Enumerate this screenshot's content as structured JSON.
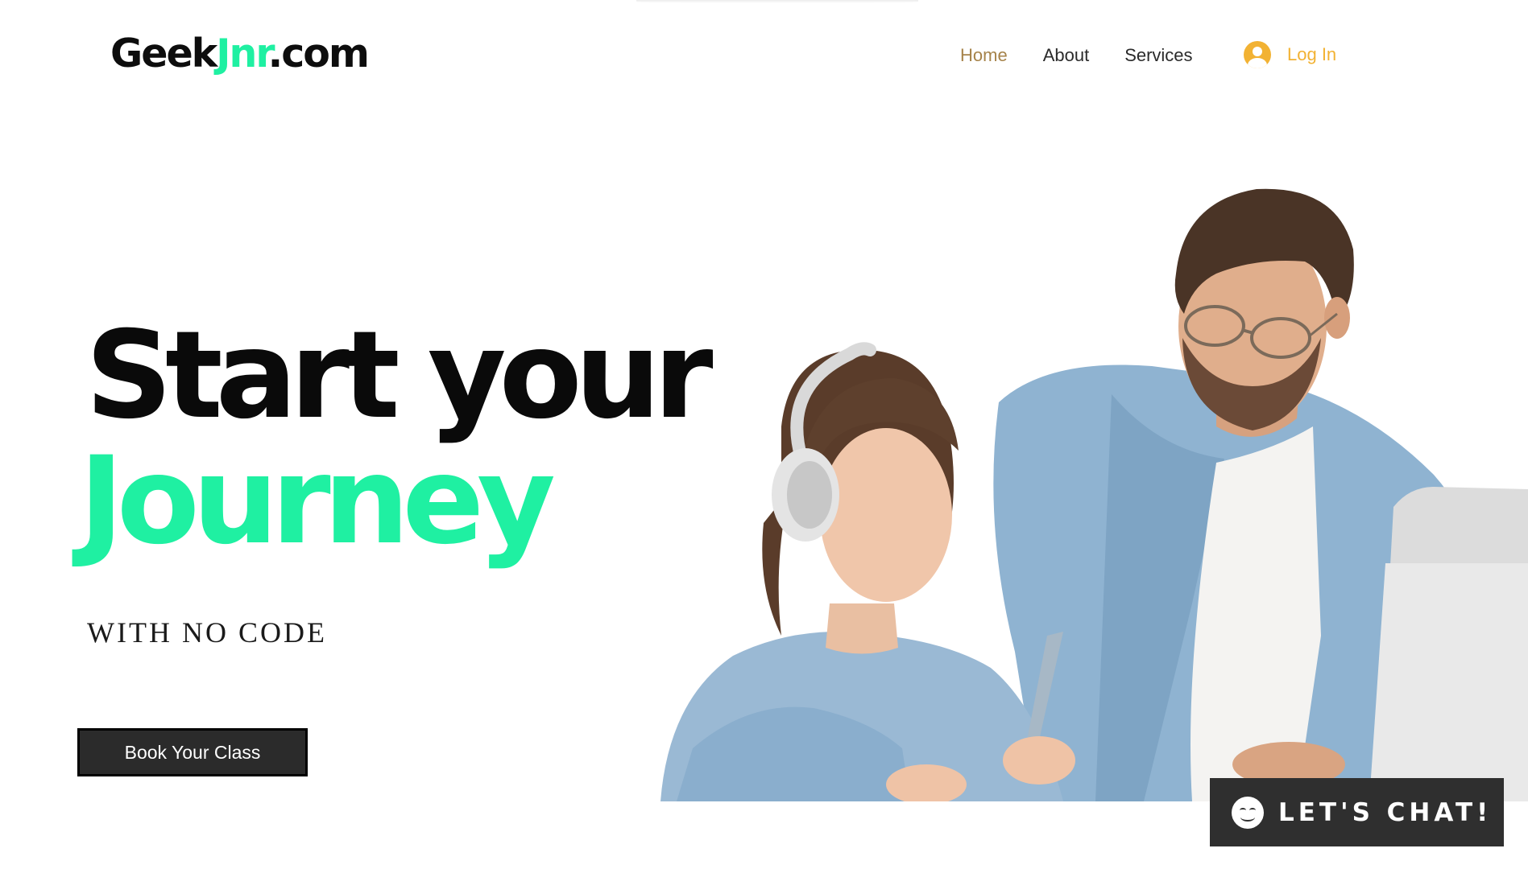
{
  "header": {
    "logo": {
      "part1": "Geek",
      "part2": "Jnr",
      "part3": ".com"
    },
    "nav": [
      {
        "label": "Home",
        "active": true
      },
      {
        "label": "About",
        "active": false
      },
      {
        "label": "Services",
        "active": false
      }
    ],
    "login_label": "Log In"
  },
  "hero": {
    "line1": "Start your",
    "line2": "Journey",
    "subtitle": "WITH NO CODE",
    "cta_label": "Book Your Class"
  },
  "chat": {
    "label": "LET'S CHAT!"
  },
  "colors": {
    "accent_green": "#1ff0a2",
    "nav_active": "#a6834a",
    "login": "#f2b233",
    "button_bg": "#2b2b2b",
    "chat_bg": "#2f2f2f"
  },
  "icons": {
    "login": "user-avatar-icon",
    "chat": "smiley-icon"
  }
}
